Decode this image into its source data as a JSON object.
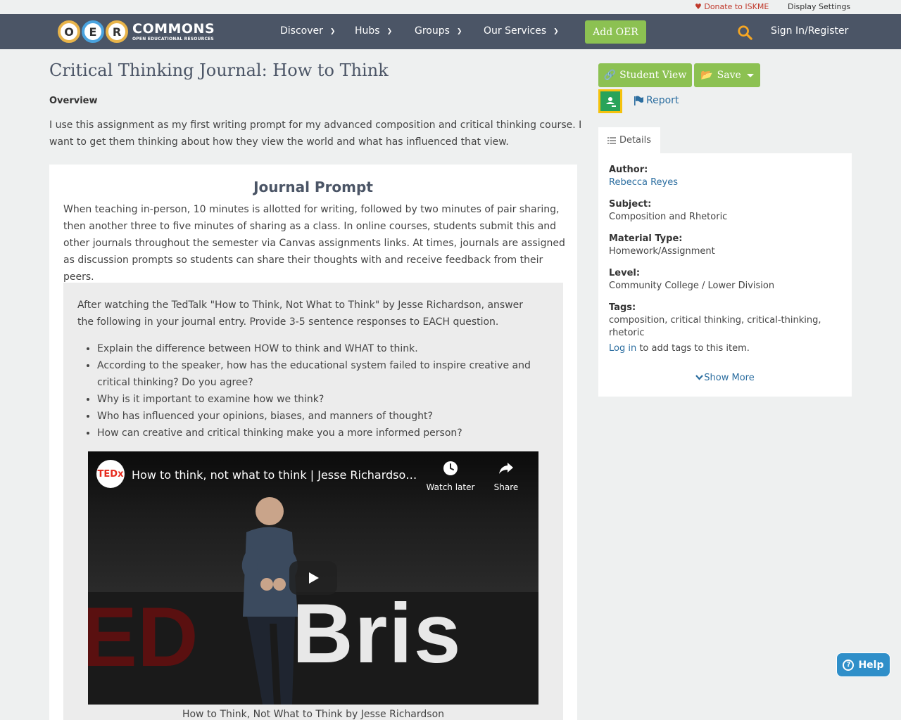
{
  "utility": {
    "donate": "Donate to ISKME",
    "display_settings": "Display Settings"
  },
  "nav": {
    "logo_letters": [
      "O",
      "E",
      "R"
    ],
    "logo_word": "COMMONS",
    "logo_tagline": "OPEN EDUCATIONAL RESOURCES",
    "items": [
      "Discover",
      "Hubs",
      "Groups",
      "Our Services"
    ],
    "add_oer": "Add OER",
    "sign_in": "Sign In/Register"
  },
  "page": {
    "title": "Critical Thinking Journal: How to Think",
    "overview_label": "Overview",
    "overview_text": "I use this assignment as my first writing prompt for my advanced composition and critical thinking course. I want to get them thinking about how they view the world and what has influenced that view."
  },
  "card": {
    "heading": "Journal Prompt",
    "paragraph": "When teaching in-person, 10 minutes is allotted for writing, followed by two minutes of pair sharing, then another three to five minutes of sharing as a class. In online courses, students submit this and other journals throughout the semester via Canvas assignments links. At times, journals are assigned as discussion prompts so students can share their thoughts with and receive feedback from their peers.",
    "inset_text": "After watching the TedTalk \"How to Think, Not What to Think\" by Jesse Richardson, answer the following in your journal entry. Provide 3-5 sentence responses to EACH question.",
    "questions": [
      "Explain the difference between HOW to think and WHAT to think.",
      "According to the speaker, how has the educational system failed to inspire creative and critical thinking? Do you agree?",
      "Why is it important to examine how we think?",
      "Who has influenced your opinions, biases, and manners of thought?",
      "How can creative and critical thinking make you a more informed person?"
    ],
    "video": {
      "title": "How to think, not what to think | Jesse Richardson | TEDxBrisbane",
      "channel_badge": "TEDx",
      "watch_later": "Watch later",
      "share": "Share",
      "backdrop_left": "ED",
      "backdrop_right": "Bris"
    },
    "caption": "How to Think, Not What to Think by Jesse Richardson"
  },
  "sidebar": {
    "student_view": "Student View",
    "save": "Save",
    "report": "Report",
    "details_tab": "Details",
    "author_label": "Author:",
    "author": "Rebecca Reyes",
    "subject_label": "Subject:",
    "subject": "Composition and Rhetoric",
    "material_label": "Material Type:",
    "material": "Homework/Assignment",
    "level_label": "Level:",
    "level": "Community College / Lower Division",
    "tags_label": "Tags:",
    "tags": "composition, critical thinking, critical-thinking, rhetoric",
    "login": "Log in",
    "login_suffix": " to add tags to this item.",
    "show_more": "Show More"
  },
  "help": {
    "label": "Help"
  },
  "colors": {
    "nav": "#4b5566",
    "green": "#8cc152",
    "link": "#2c6ea0",
    "help": "#2f8fc9",
    "donate": "#c0392b"
  }
}
